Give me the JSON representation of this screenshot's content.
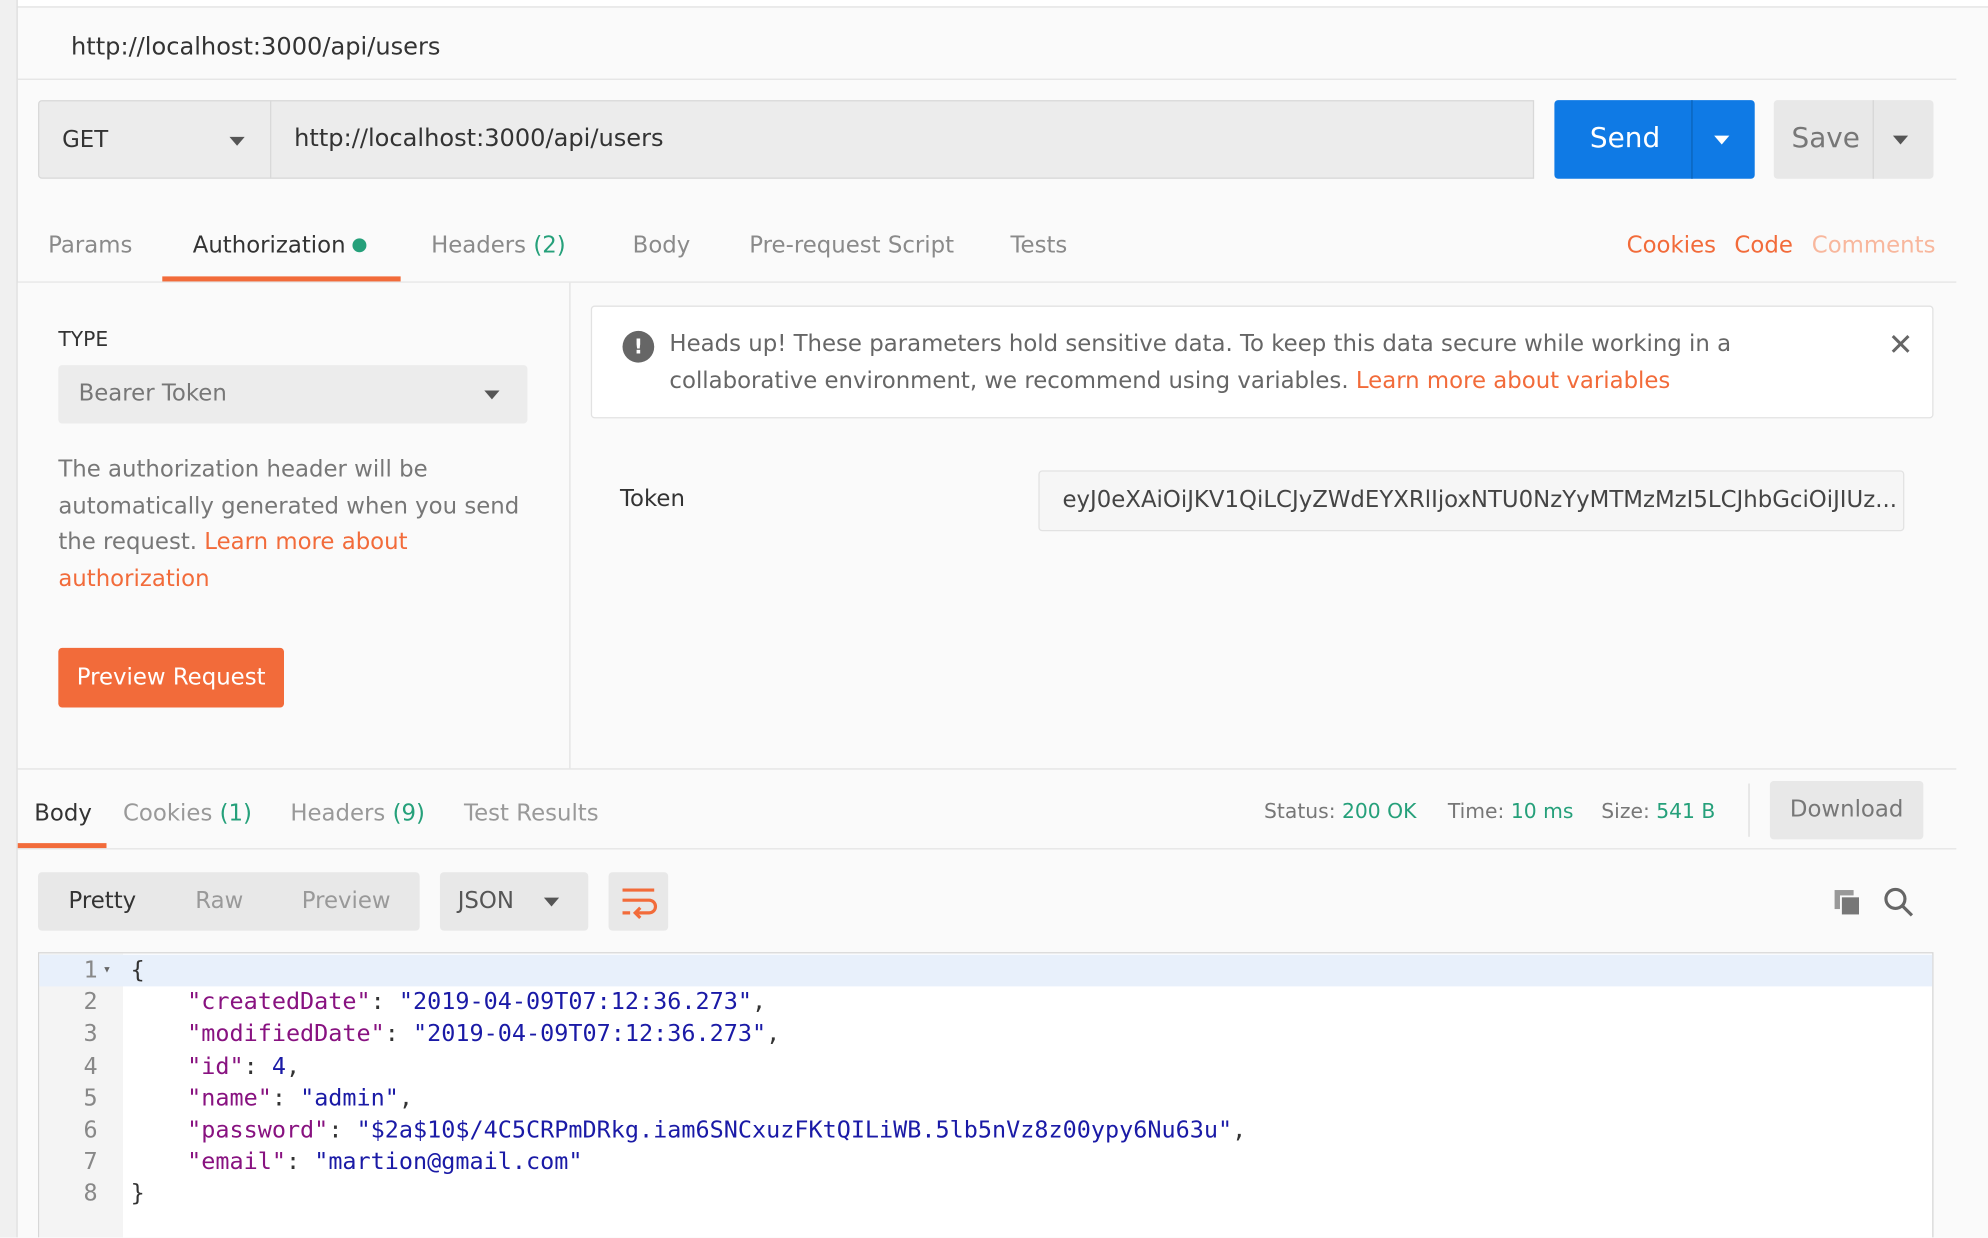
{
  "window": {
    "title": "http://localhost:3000/api/users"
  },
  "request": {
    "method": "GET",
    "url": "http://localhost:3000/api/users",
    "send_label": "Send",
    "save_label": "Save"
  },
  "request_tabs": [
    {
      "label": "Params"
    },
    {
      "label": "Authorization",
      "active": true,
      "indicator_color": "#25a07a"
    },
    {
      "label": "Headers",
      "count": "(2)"
    },
    {
      "label": "Body"
    },
    {
      "label": "Pre-request Script"
    },
    {
      "label": "Tests"
    }
  ],
  "right_links": {
    "cookies": "Cookies",
    "code": "Code",
    "comments": "Comments"
  },
  "auth": {
    "type_label": "TYPE",
    "type_value": "Bearer Token",
    "description": "The authorization header will be automatically generated when you send the request.",
    "learn_more": "Learn more about authorization",
    "preview_button": "Preview Request",
    "alert_text": "Heads up! These parameters hold sensitive data. To keep this data secure while working in a collaborative environment, we recommend using variables.",
    "alert_link": "Learn more about variables",
    "token_label": "Token",
    "token_value": "eyJ0eXAiOiJKV1QiLCJyZWdEYXRlIjoxNTU0NzYyMTMzMzI5LCJhbGciOiJIUz..."
  },
  "response": {
    "tabs": [
      {
        "label": "Body",
        "active": true
      },
      {
        "label": "Cookies",
        "count": "(1)"
      },
      {
        "label": "Headers",
        "count": "(9)"
      },
      {
        "label": "Test Results"
      }
    ],
    "status_label": "Status:",
    "status": "200 OK",
    "time_label": "Time:",
    "time": "10 ms",
    "size_label": "Size:",
    "size": "541 B",
    "download": "Download",
    "view_modes": [
      "Pretty",
      "Raw",
      "Preview"
    ],
    "format": "JSON",
    "lines": [
      {
        "n": "1",
        "text": "{"
      },
      {
        "n": "2",
        "key": "\"createdDate\"",
        "value": "\"2019-04-09T07:12:36.273\"",
        "comma": ","
      },
      {
        "n": "3",
        "key": "\"modifiedDate\"",
        "value": "\"2019-04-09T07:12:36.273\"",
        "comma": ","
      },
      {
        "n": "4",
        "key": "\"id\"",
        "value": "4",
        "comma": ","
      },
      {
        "n": "5",
        "key": "\"name\"",
        "value": "\"admin\"",
        "comma": ","
      },
      {
        "n": "6",
        "key": "\"password\"",
        "value": "\"$2a$10$/4C5CRPmDRkg.iam6SNCxuzFKtQILiWB.5lb5nVz8z00ypy6Nu63u\"",
        "comma": ","
      },
      {
        "n": "7",
        "key": "\"email\"",
        "value": "\"martion@gmail.com\"",
        "comma": ""
      },
      {
        "n": "8",
        "text": "}"
      }
    ]
  },
  "colors": {
    "accent": "#f26b3a",
    "send": "#0f7ae5",
    "success": "#25a07a"
  }
}
